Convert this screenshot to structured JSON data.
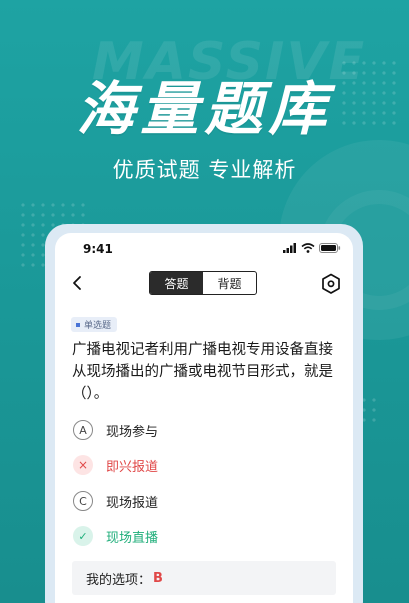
{
  "hero": {
    "watermark": "MASSIVE",
    "title": "海量题库",
    "subtitle": "优质试题  专业解析"
  },
  "status_bar": {
    "time": "9:41"
  },
  "nav": {
    "tabs": [
      {
        "label": "答题",
        "active": true
      },
      {
        "label": "背题",
        "active": false
      }
    ]
  },
  "question": {
    "type_label": "单选题",
    "text": "广播电视记者利用广播电视专用设备直接从现场播出的广播或电视节目形式，就是（）。",
    "options": [
      {
        "badge": "A",
        "text": "现场参与",
        "state": "normal"
      },
      {
        "badge": "×",
        "text": "即兴报道",
        "state": "wrong"
      },
      {
        "badge": "C",
        "text": "现场报道",
        "state": "normal"
      },
      {
        "badge": "✓",
        "text": "现场直播",
        "state": "correct"
      }
    ]
  },
  "answer": {
    "label": "我的选项：",
    "value": "B"
  },
  "colors": {
    "background": "#1a9a9a",
    "wrong": "#e04848",
    "correct": "#1fae7a"
  }
}
